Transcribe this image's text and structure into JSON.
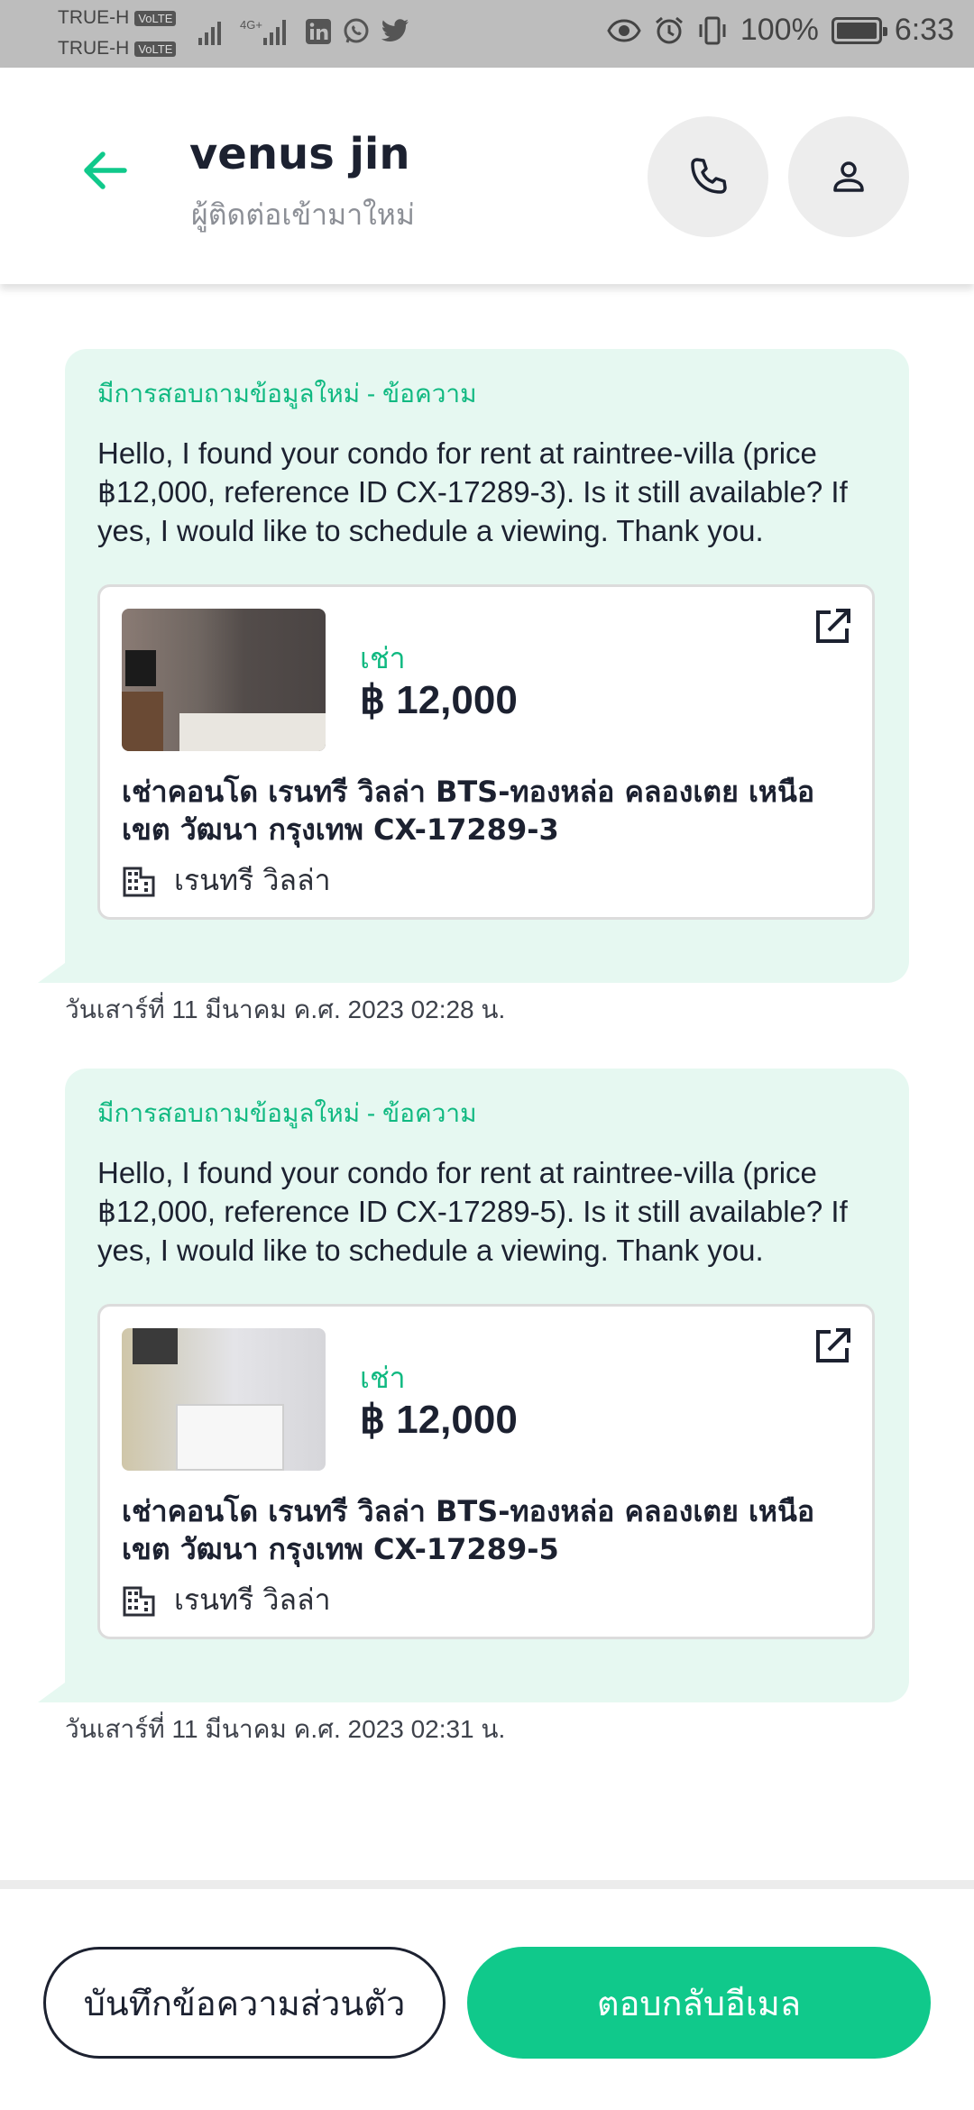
{
  "status_bar": {
    "carrier_1": "TRUE-H",
    "carrier_2": "TRUE-H",
    "volte": "VoLTE",
    "network": "4G+",
    "battery": "100%",
    "time": "6:33",
    "icons": [
      "signal-icon",
      "linkedin-icon",
      "whatsapp-icon",
      "twitter-icon",
      "eye-icon",
      "alarm-icon",
      "vibrate-icon",
      "battery-icon"
    ]
  },
  "header": {
    "title": "venus jin",
    "subtitle": "ผู้ติดต่อเข้ามาใหม่"
  },
  "messages": [
    {
      "label": "มีการสอบถามข้อมูลใหม่ - ข้อความ",
      "text": "Hello, I found your condo for rent at raintree-villa (price ฿12,000, reference ID CX-17289-3). Is it still available? If yes, I would like to schedule a viewing. Thank you.",
      "listing": {
        "type_label": "เช่า",
        "price": "฿ 12,000",
        "title": "เช่าคอนโด  เรนทรี วิลล่า BTS-ทองหล่อ คลองเตย เหนือ เขต วัฒนา กรุงเทพ CX-17289-3",
        "building": "เรนทรี วิลล่า"
      },
      "timestamp": "วันเสาร์ที่ 11 มีนาคม ค.ศ. 2023 02:28 น."
    },
    {
      "label": "มีการสอบถามข้อมูลใหม่ - ข้อความ",
      "text": "Hello, I found your condo for rent at raintree-villa (price ฿12,000, reference ID CX-17289-5). Is it still available? If yes, I would like to schedule a viewing. Thank you.",
      "listing": {
        "type_label": "เช่า",
        "price": "฿ 12,000",
        "title": "เช่าคอนโด  เรนทรี วิลล่า BTS-ทองหล่อ คลองเตย เหนือ เขต วัฒนา กรุงเทพ CX-17289-5",
        "building": "เรนทรี วิลล่า"
      },
      "timestamp": "วันเสาร์ที่ 11 มีนาคม ค.ศ. 2023 02:31 น."
    }
  ],
  "footer": {
    "note_button": "บันทึกข้อความส่วนตัว",
    "reply_button": "ตอบกลับอีเมล"
  },
  "colors": {
    "accent": "#10c98b",
    "bubble": "#e6f8f1",
    "label_green": "#10b981"
  }
}
